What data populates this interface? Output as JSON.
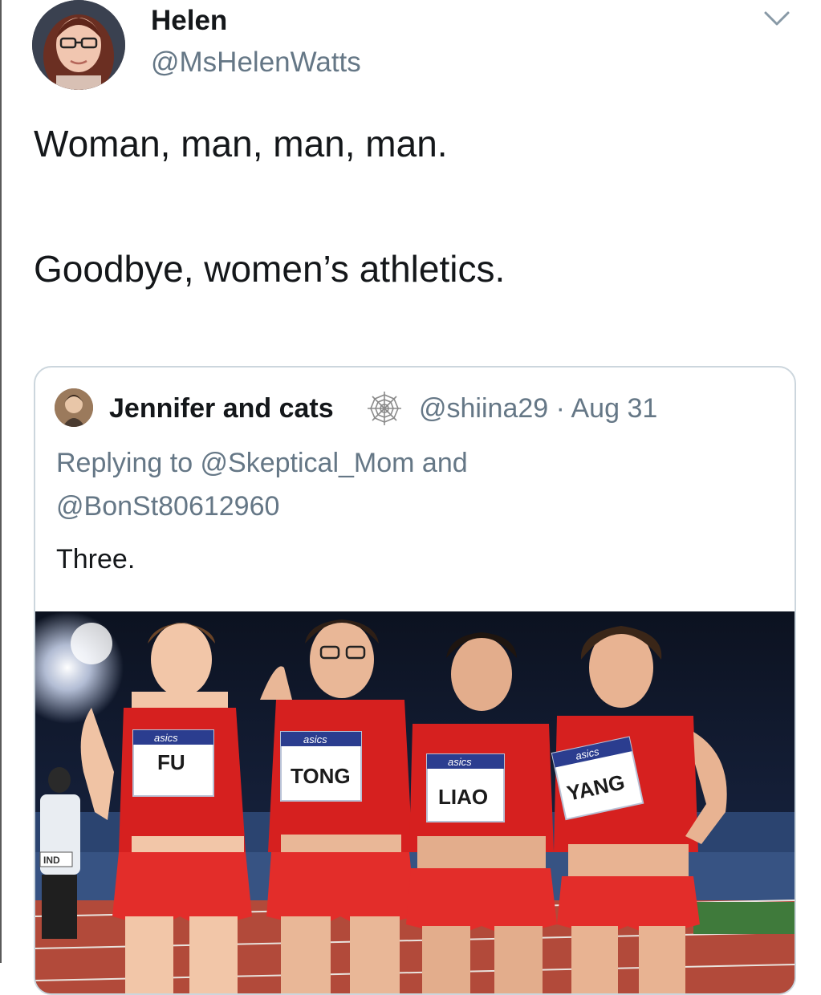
{
  "tweet": {
    "author_name": "Helen",
    "author_handle": "@MsHelenWatts",
    "lines": [
      "Woman, man, man, man.",
      "Goodbye, women’s athletics."
    ]
  },
  "quote": {
    "author_name": "Jennifer and cats",
    "handle_date": "@shiina29 · Aug 31",
    "reply_line1": "Replying to @Skeptical_Mom and",
    "reply_line2": "@BonSt80612960",
    "text": "Three.",
    "photo": {
      "bibs": [
        "FU",
        "TONG",
        "LIAO",
        "YANG"
      ],
      "sponsor": "asics",
      "sign_text": "IND"
    }
  },
  "icons": {
    "menu": "chevron-down-icon",
    "badge": "spiderweb-icon"
  },
  "colors": {
    "text": "#14171a",
    "secondary": "#657786",
    "border": "#ccd6dd",
    "kit_red": "#d6201f"
  }
}
